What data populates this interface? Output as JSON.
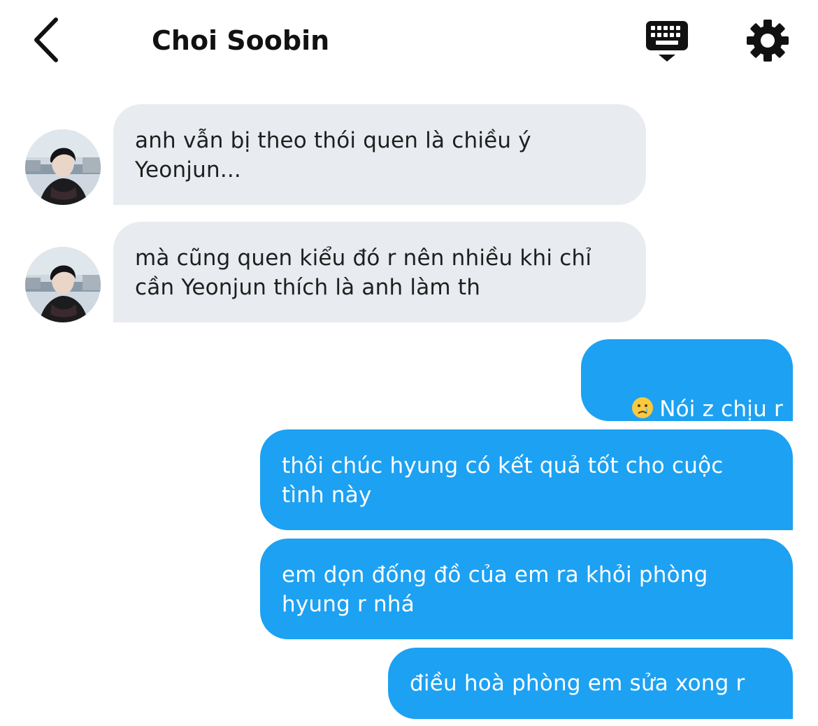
{
  "header": {
    "title": "Choi Soobin",
    "back_icon": "chevron-left-icon",
    "keyboard_icon": "keyboard-icon",
    "settings_icon": "gear-icon"
  },
  "colors": {
    "outgoing_bubble": "#1da1f2",
    "incoming_bubble": "#e8ebef",
    "text_dark": "#111111"
  },
  "messages": [
    {
      "direction": "incoming",
      "text": "anh vẫn bị theo thói quen là chiều ý\nYeonjun..."
    },
    {
      "direction": "incoming",
      "text": "mà cũng quen kiểu đó r nên nhiều khi chỉ\ncần Yeonjun thích là anh làm th"
    },
    {
      "direction": "outgoing",
      "emoji": "crying-face-emoji",
      "text": "Nói z chịu r"
    },
    {
      "direction": "outgoing",
      "text": "thôi chúc hyung có kết quả tốt cho cuộc\ntình này"
    },
    {
      "direction": "outgoing",
      "text": "em dọn đống đồ của em ra khỏi phòng\nhyung r nhá"
    },
    {
      "direction": "outgoing",
      "text": "điều hoà phòng em sửa xong r"
    }
  ]
}
